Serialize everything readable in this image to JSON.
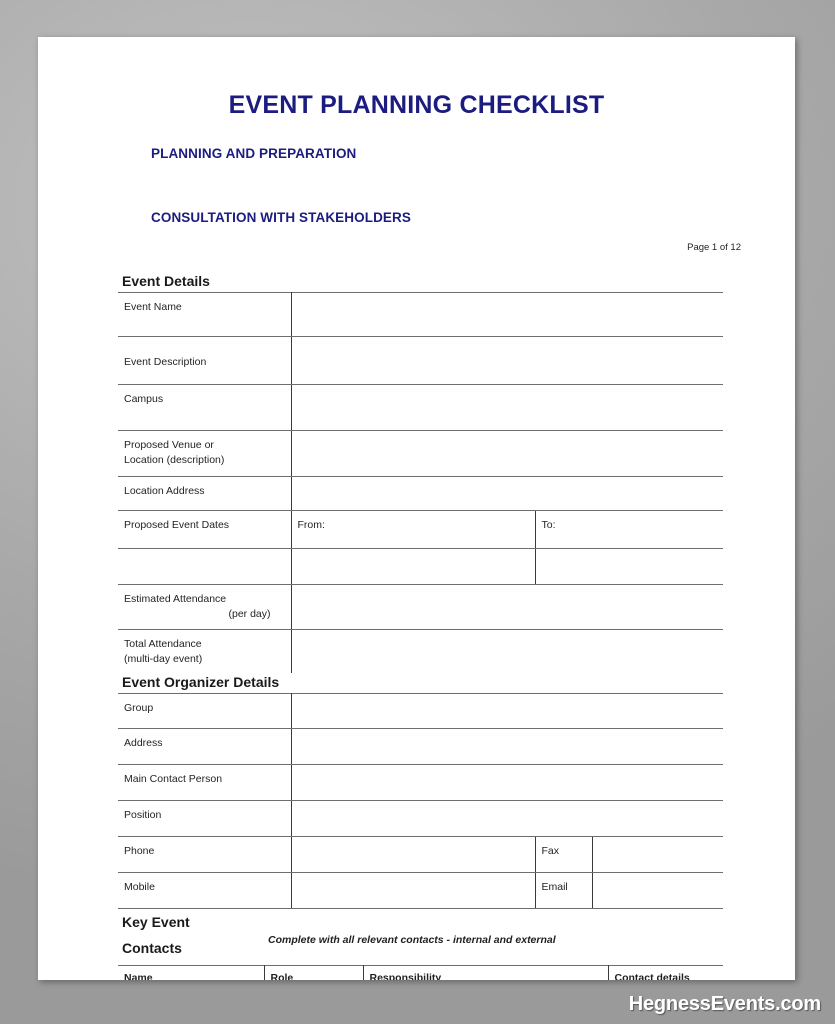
{
  "document": {
    "title": "EVENT PLANNING CHECKLIST",
    "subheading_1": "PLANNING AND PREPARATION",
    "subheading_2": "CONSULTATION WITH STAKEHOLDERS",
    "page_indicator": "Page 1 of 12",
    "title_color": "#1c1c80",
    "text_color": "#231f20",
    "rule_color": "#6e6e6e"
  },
  "event_details": {
    "section_title": "Event Details",
    "rows": [
      {
        "label": "Event Name"
      },
      {
        "label": "Event Description"
      },
      {
        "label": "Campus"
      },
      {
        "label_line1": "Proposed Venue or",
        "label_line2": "Location (description)"
      },
      {
        "label": "Location Address"
      },
      {
        "label": "Proposed Event Dates",
        "from_label": "From:",
        "to_label": "To:"
      },
      {
        "label": ""
      },
      {
        "label_line1": "Estimated Attendance",
        "label_line2": "(per day)"
      },
      {
        "label_line1": "Total Attendance",
        "label_line2": "(multi-day event)"
      }
    ]
  },
  "event_organizer_details": {
    "section_title": "Event Organizer Details",
    "rows": [
      {
        "label": "Group"
      },
      {
        "label": "Address"
      },
      {
        "label": "Main Contact Person"
      },
      {
        "label": "Position"
      },
      {
        "label": "Phone",
        "second_label": "Fax"
      },
      {
        "label": "Mobile",
        "second_label": "Email"
      }
    ]
  },
  "key_event_contacts": {
    "title_line1": "Key Event",
    "title_line2": "Contacts",
    "note": "Complete with all relevant contacts - internal and external",
    "columns": [
      "Name",
      "Role",
      "Responsibility",
      "Contact details"
    ]
  },
  "watermark": {
    "text": "HegnessEvents.com"
  }
}
